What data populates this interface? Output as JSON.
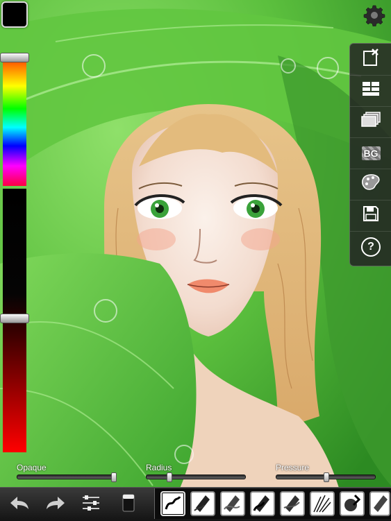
{
  "canvas": {
    "subject": "painting-of-girl-under-leaf"
  },
  "colors": {
    "current": "#000000",
    "panel": "#232323"
  },
  "left_strip": {
    "swatch": "#000000",
    "hue_handle": 0.02,
    "shade_handle": 0.49
  },
  "right_panel": {
    "buttons": [
      "new-canvas-icon",
      "grid-icon",
      "layers-icon",
      "background-icon",
      "palette-icon",
      "save-icon",
      "help-icon"
    ],
    "bg_label": "BG",
    "help_label": "?"
  },
  "sliders": {
    "opaque": {
      "label": "Opaque",
      "value": 0.98
    },
    "radius": {
      "label": "Radius",
      "value": 0.23
    },
    "pressure": {
      "label": "Pressure",
      "value": 0.51
    }
  },
  "toolbar": {
    "undo_icon": "undo-arrow-icon",
    "redo_icon": "redo-arrow-icon",
    "settings_icon": "sliders-icon",
    "eraser_icon": "eraser-icon",
    "brushes": [
      "brush-1",
      "brush-2",
      "brush-3",
      "brush-4",
      "brush-5",
      "brush-6",
      "brush-7",
      "brush-8"
    ],
    "selected_brush": 0
  }
}
